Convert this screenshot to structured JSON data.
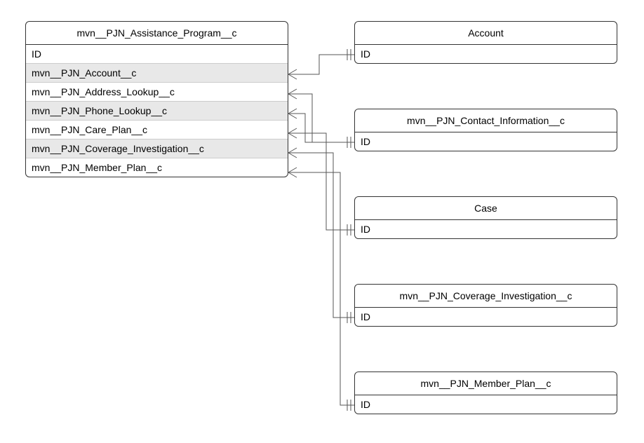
{
  "entities": {
    "main": {
      "title": "mvn__PJN_Assistance_Program__c",
      "fields": [
        "ID",
        "mvn__PJN_Account__c",
        "mvn__PJN_Address_Lookup__c",
        "mvn__PJN_Phone_Lookup__c",
        "mvn__PJN_Care_Plan__c",
        "mvn__PJN_Coverage_Investigation__c",
        "mvn__PJN_Member_Plan__c"
      ]
    },
    "account": {
      "title": "Account",
      "fields": [
        "ID"
      ]
    },
    "contact_info": {
      "title": "mvn__PJN_Contact_Information__c",
      "fields": [
        "ID"
      ]
    },
    "case": {
      "title": "Case",
      "fields": [
        "ID"
      ]
    },
    "coverage": {
      "title": "mvn__PJN_Coverage_Investigation__c",
      "fields": [
        "ID"
      ]
    },
    "member_plan": {
      "title": "mvn__PJN_Member_Plan__c",
      "fields": [
        "ID"
      ]
    }
  },
  "relationships": [
    {
      "from_field": "mvn__PJN_Account__c",
      "to_entity": "Account",
      "type": "many-to-one"
    },
    {
      "from_field": "mvn__PJN_Address_Lookup__c",
      "to_entity": "mvn__PJN_Contact_Information__c",
      "type": "many-to-one"
    },
    {
      "from_field": "mvn__PJN_Phone_Lookup__c",
      "to_entity": "mvn__PJN_Contact_Information__c",
      "type": "many-to-one"
    },
    {
      "from_field": "mvn__PJN_Care_Plan__c",
      "to_entity": "Case",
      "type": "many-to-one"
    },
    {
      "from_field": "mvn__PJN_Coverage_Investigation__c",
      "to_entity": "mvn__PJN_Coverage_Investigation__c",
      "type": "many-to-one"
    },
    {
      "from_field": "mvn__PJN_Member_Plan__c",
      "to_entity": "mvn__PJN_Member_Plan__c",
      "type": "many-to-one"
    }
  ]
}
